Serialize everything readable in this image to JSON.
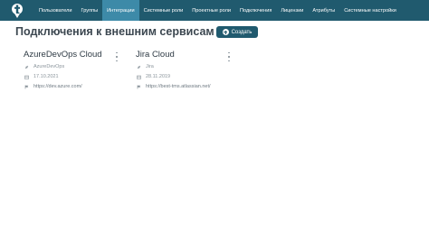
{
  "nav": {
    "items": [
      {
        "label": "Пользователи"
      },
      {
        "label": "Группы"
      },
      {
        "label": "Интеграции"
      },
      {
        "label": "Системные роли"
      },
      {
        "label": "Проектные роли"
      },
      {
        "label": "Подключения"
      },
      {
        "label": "Лицензии"
      },
      {
        "label": "Атрибуты"
      },
      {
        "label": "Системные настройки"
      }
    ],
    "active_index": 2
  },
  "page": {
    "title": "Подключения к внешним сервисам",
    "create_label": "Создать"
  },
  "cards": [
    {
      "title": "AzureDevOps Cloud",
      "type": "AzureDevOps",
      "date": "17.10.2021",
      "url": "https://dev.azure.com/"
    },
    {
      "title": "Jira Cloud",
      "type": "Jira",
      "date": "28.11.2019",
      "url": "https://best-tms.atlassian.net/"
    }
  ],
  "colors": {
    "topbar": "#205a6e",
    "active_tab": "#3d8aa8",
    "button": "#205a6e"
  }
}
